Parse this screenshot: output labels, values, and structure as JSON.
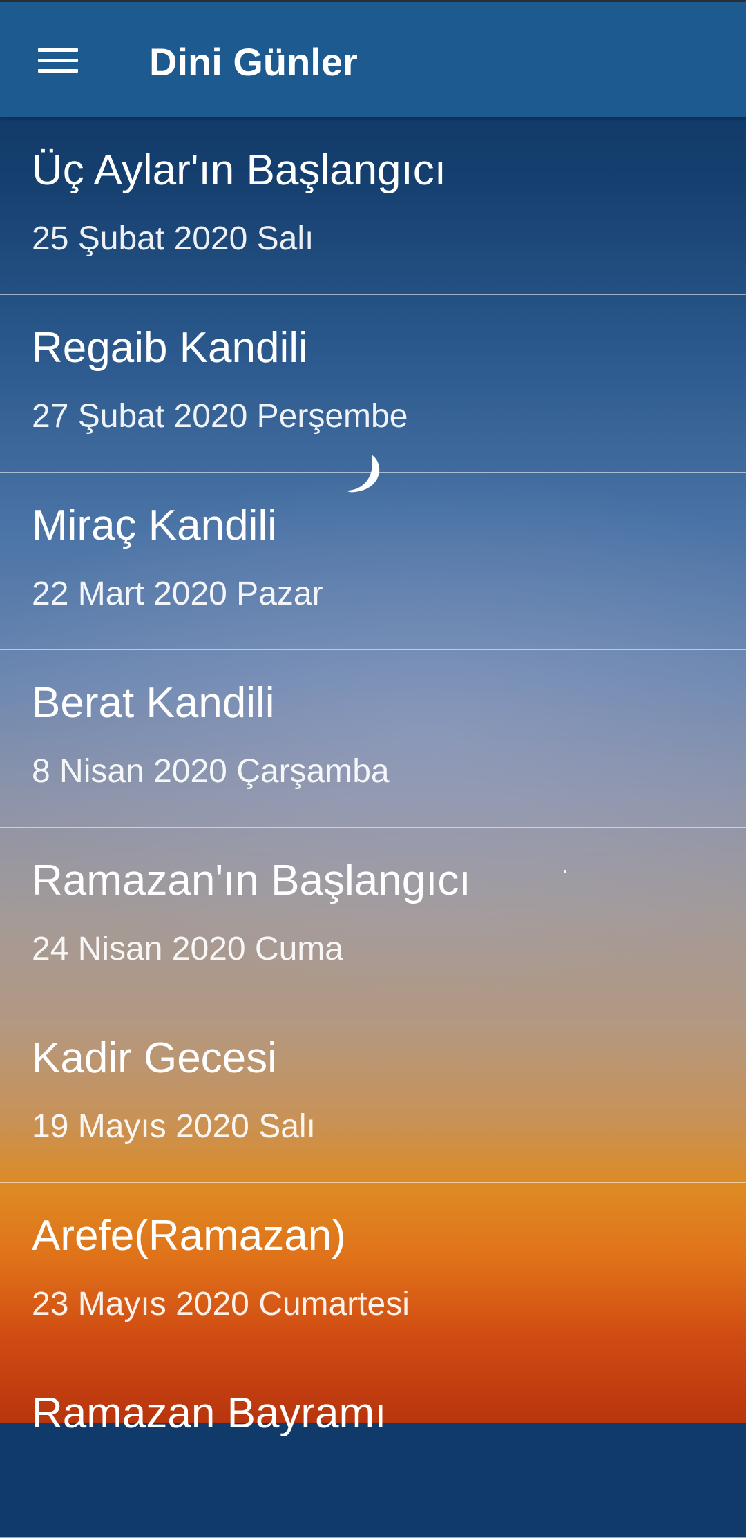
{
  "appbar": {
    "title": "Dini Günler",
    "menu_icon": "menu-icon"
  },
  "days": [
    {
      "name": "Üç Aylar'ın Başlangıcı",
      "date": "25 Şubat 2020 Salı"
    },
    {
      "name": "Regaib Kandili",
      "date": "27 Şubat 2020 Perşembe"
    },
    {
      "name": "Miraç Kandili",
      "date": "22 Mart 2020 Pazar"
    },
    {
      "name": "Berat Kandili",
      "date": "8 Nisan 2020 Çarşamba"
    },
    {
      "name": "Ramazan'ın Başlangıcı",
      "date": "24 Nisan 2020 Cuma"
    },
    {
      "name": "Kadir Gecesi",
      "date": "19 Mayıs 2020 Salı"
    },
    {
      "name": "Arefe(Ramazan)",
      "date": "23 Mayıs 2020 Cumartesi"
    },
    {
      "name": "Ramazan Bayramı",
      "date": ""
    }
  ],
  "colors": {
    "appbar": "#1d5a90",
    "text": "#ffffff"
  }
}
